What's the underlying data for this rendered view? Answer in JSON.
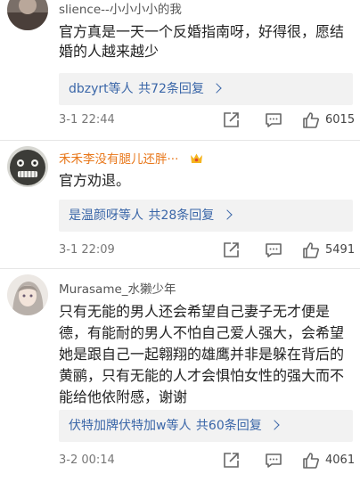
{
  "comments": [
    {
      "username": "slience--小小小小的我",
      "text": "官方真是一天一个反婚指南呀，好得很，愿结婚的人越来越少",
      "reply_names": "dbzyrt等人",
      "reply_count": "共72条回复",
      "time": "3-1 22:44",
      "likes": "6015"
    },
    {
      "username": "禾禾李没有腿儿还胖···",
      "text": "官方劝退。",
      "reply_names": "是温颜呀等人",
      "reply_count": "共28条回复",
      "time": "3-1 22:09",
      "likes": "5491"
    },
    {
      "username": "Murasame_水獭少年",
      "text": "只有无能的男人还会希望自己妻子无才便是德，有能耐的男人不怕自己爱人强大，会希望她是跟自己一起翱翔的雄鹰并非是躲在背后的黄鹂，只有无能的人才会惧怕女性的强大而不能给他依附感，谢谢",
      "reply_names": "伏特加牌伏特加w等人",
      "reply_count": "共60条回复",
      "time": "3-2 00:14",
      "likes": "4061"
    }
  ],
  "icons": {
    "share": "share-icon",
    "comment": "comment-icon",
    "like": "thumbs-up-icon",
    "badge": "crown-badge-icon"
  },
  "colors": {
    "link": "#3a66a8",
    "username_highlight": "#e8771a",
    "reply_bg": "#f2f2f2"
  }
}
